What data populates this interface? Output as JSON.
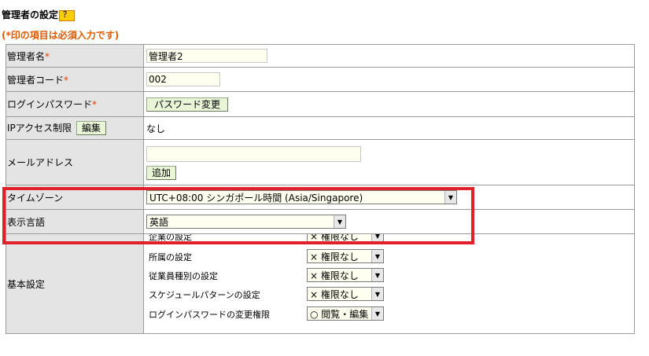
{
  "page": {
    "title": "管理者の設定",
    "help_label": "？",
    "required_note": "(*印の項目は必須入力です)"
  },
  "rows": {
    "admin_name": {
      "label": "管理者名",
      "star": "*",
      "value": "管理者2"
    },
    "admin_code": {
      "label": "管理者コード",
      "star": "*",
      "value": "002"
    },
    "login_password": {
      "label": "ログインパスワード",
      "star": "*",
      "button": "パスワード変更"
    },
    "ip_access": {
      "label": "IPアクセス制限",
      "edit_button": "編集",
      "value": "なし"
    },
    "email": {
      "label": "メールアドレス",
      "value": "",
      "add_button": "追加"
    },
    "timezone": {
      "label": "タイムゾーン",
      "selected": "UTC+08:00 シンガポール時間 (Asia/Singapore)"
    },
    "language": {
      "label": "表示言語",
      "selected": "英語"
    },
    "basic_settings": {
      "label": "基本設定",
      "items": [
        {
          "label": "企業の設定",
          "value": "× 権限なし"
        },
        {
          "label": "所属の設定",
          "value": "× 権限なし"
        },
        {
          "label": "従業員種別の設定",
          "value": "× 権限なし"
        },
        {
          "label": "スケジュールパターンの設定",
          "value": "× 権限なし"
        },
        {
          "label": "ログインパスワードの変更権限",
          "value": "○ 閲覧・編集"
        }
      ]
    }
  },
  "colors": {
    "highlight": "#e0202a",
    "required": "#e05a00",
    "label_bg": "#e4e4e4",
    "button_bg": "#e8f5d6"
  }
}
